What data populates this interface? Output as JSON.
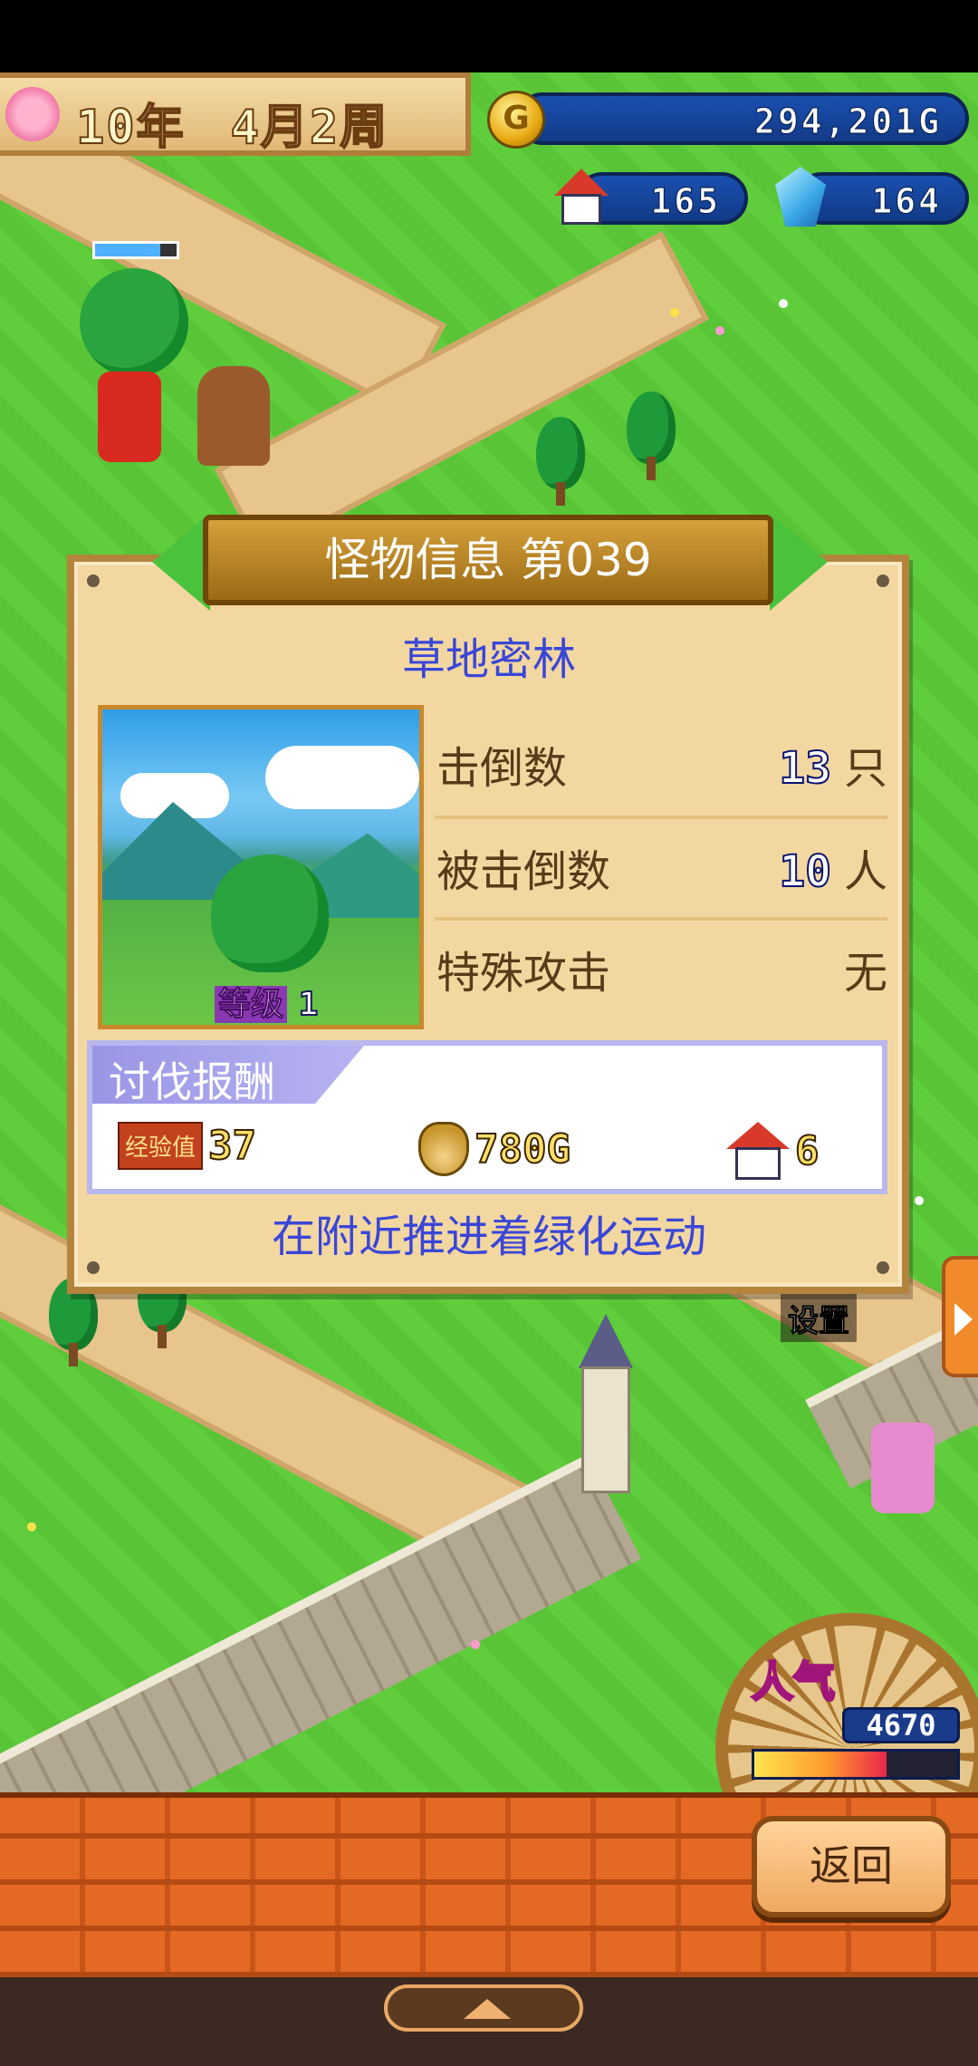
{
  "hud": {
    "date": {
      "year": "10年",
      "month_week": "4月2周"
    },
    "gold": "294,201G",
    "coin_symbol": "G",
    "houses": "165",
    "crystals": "164",
    "popularity_label": "人气",
    "popularity": "4670",
    "popularity_fill_fraction": 0.65,
    "setting_sign": "设置"
  },
  "dialog": {
    "title": "怪物信息 第039",
    "area_name": "草地密林",
    "level_label": "等级",
    "level_value": "1",
    "stats": [
      {
        "label": "击倒数",
        "value": "13",
        "unit": "只"
      },
      {
        "label": "被击倒数",
        "value": "10",
        "unit": "人"
      },
      {
        "label": "特殊攻击",
        "value": "无"
      }
    ],
    "reward_header": "讨伐报酬",
    "rewards": {
      "exp_label": "经验值",
      "exp": "37",
      "gold": "780G",
      "houses": "6"
    },
    "footer": "在附近推进着绿化运动"
  },
  "buttons": {
    "back": "返回"
  },
  "icons": {
    "prev": "arrow-left-icon",
    "next": "arrow-right-icon",
    "coin": "coin-icon",
    "house": "house-icon",
    "crystal": "crystal-icon",
    "money_bag": "money-bag-icon",
    "side_tab": "side-tab-arrow-icon",
    "nav_up": "chevron-up-icon"
  },
  "colors": {
    "accent_blue_text": "#3a46d8",
    "dialog_bg": "#f3d7a0",
    "grass": "#5fcd3c",
    "brick": "#e46a24"
  }
}
